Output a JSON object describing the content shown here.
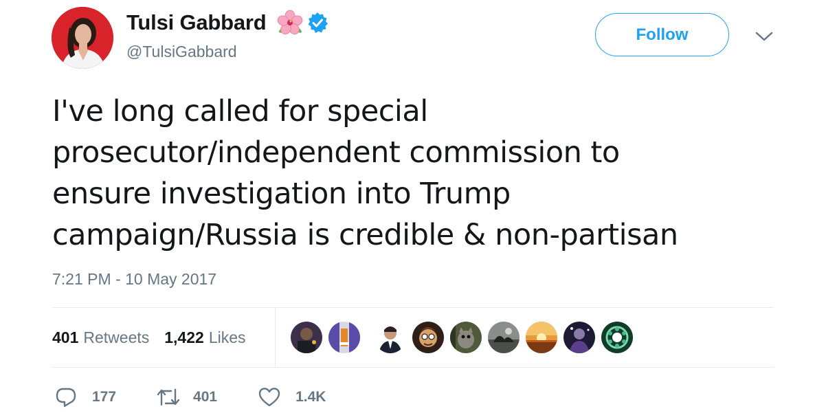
{
  "author": {
    "display_name": "Tulsi Gabbard",
    "handle": "@TulsiGabbard",
    "verified": true,
    "name_emoji": "hibiscus-icon"
  },
  "follow_button": {
    "label": "Follow"
  },
  "tweet": {
    "text": "I've long called for special\nprosecutor/independent commission to\nensure investigation into Trump\ncampaign/Russia is credible & non-partisan",
    "timestamp": "7:21 PM - 10 May 2017"
  },
  "stats": {
    "retweets_count": "401",
    "retweets_label": "Retweets",
    "likes_count": "1,422",
    "likes_label": "Likes"
  },
  "actions": {
    "reply_count": "177",
    "retweet_count": "401",
    "like_count": "1.4K"
  },
  "icons": {
    "reply": "reply-icon",
    "retweet": "retweet-icon",
    "like": "heart-icon",
    "more": "chevron-down-icon",
    "verified": "verified-badge-icon"
  },
  "colors": {
    "accent": "#1da1f2",
    "text": "#14171a",
    "secondary": "#657786",
    "divider": "#e6ecf0",
    "avatar_bg": "#d8232a"
  }
}
